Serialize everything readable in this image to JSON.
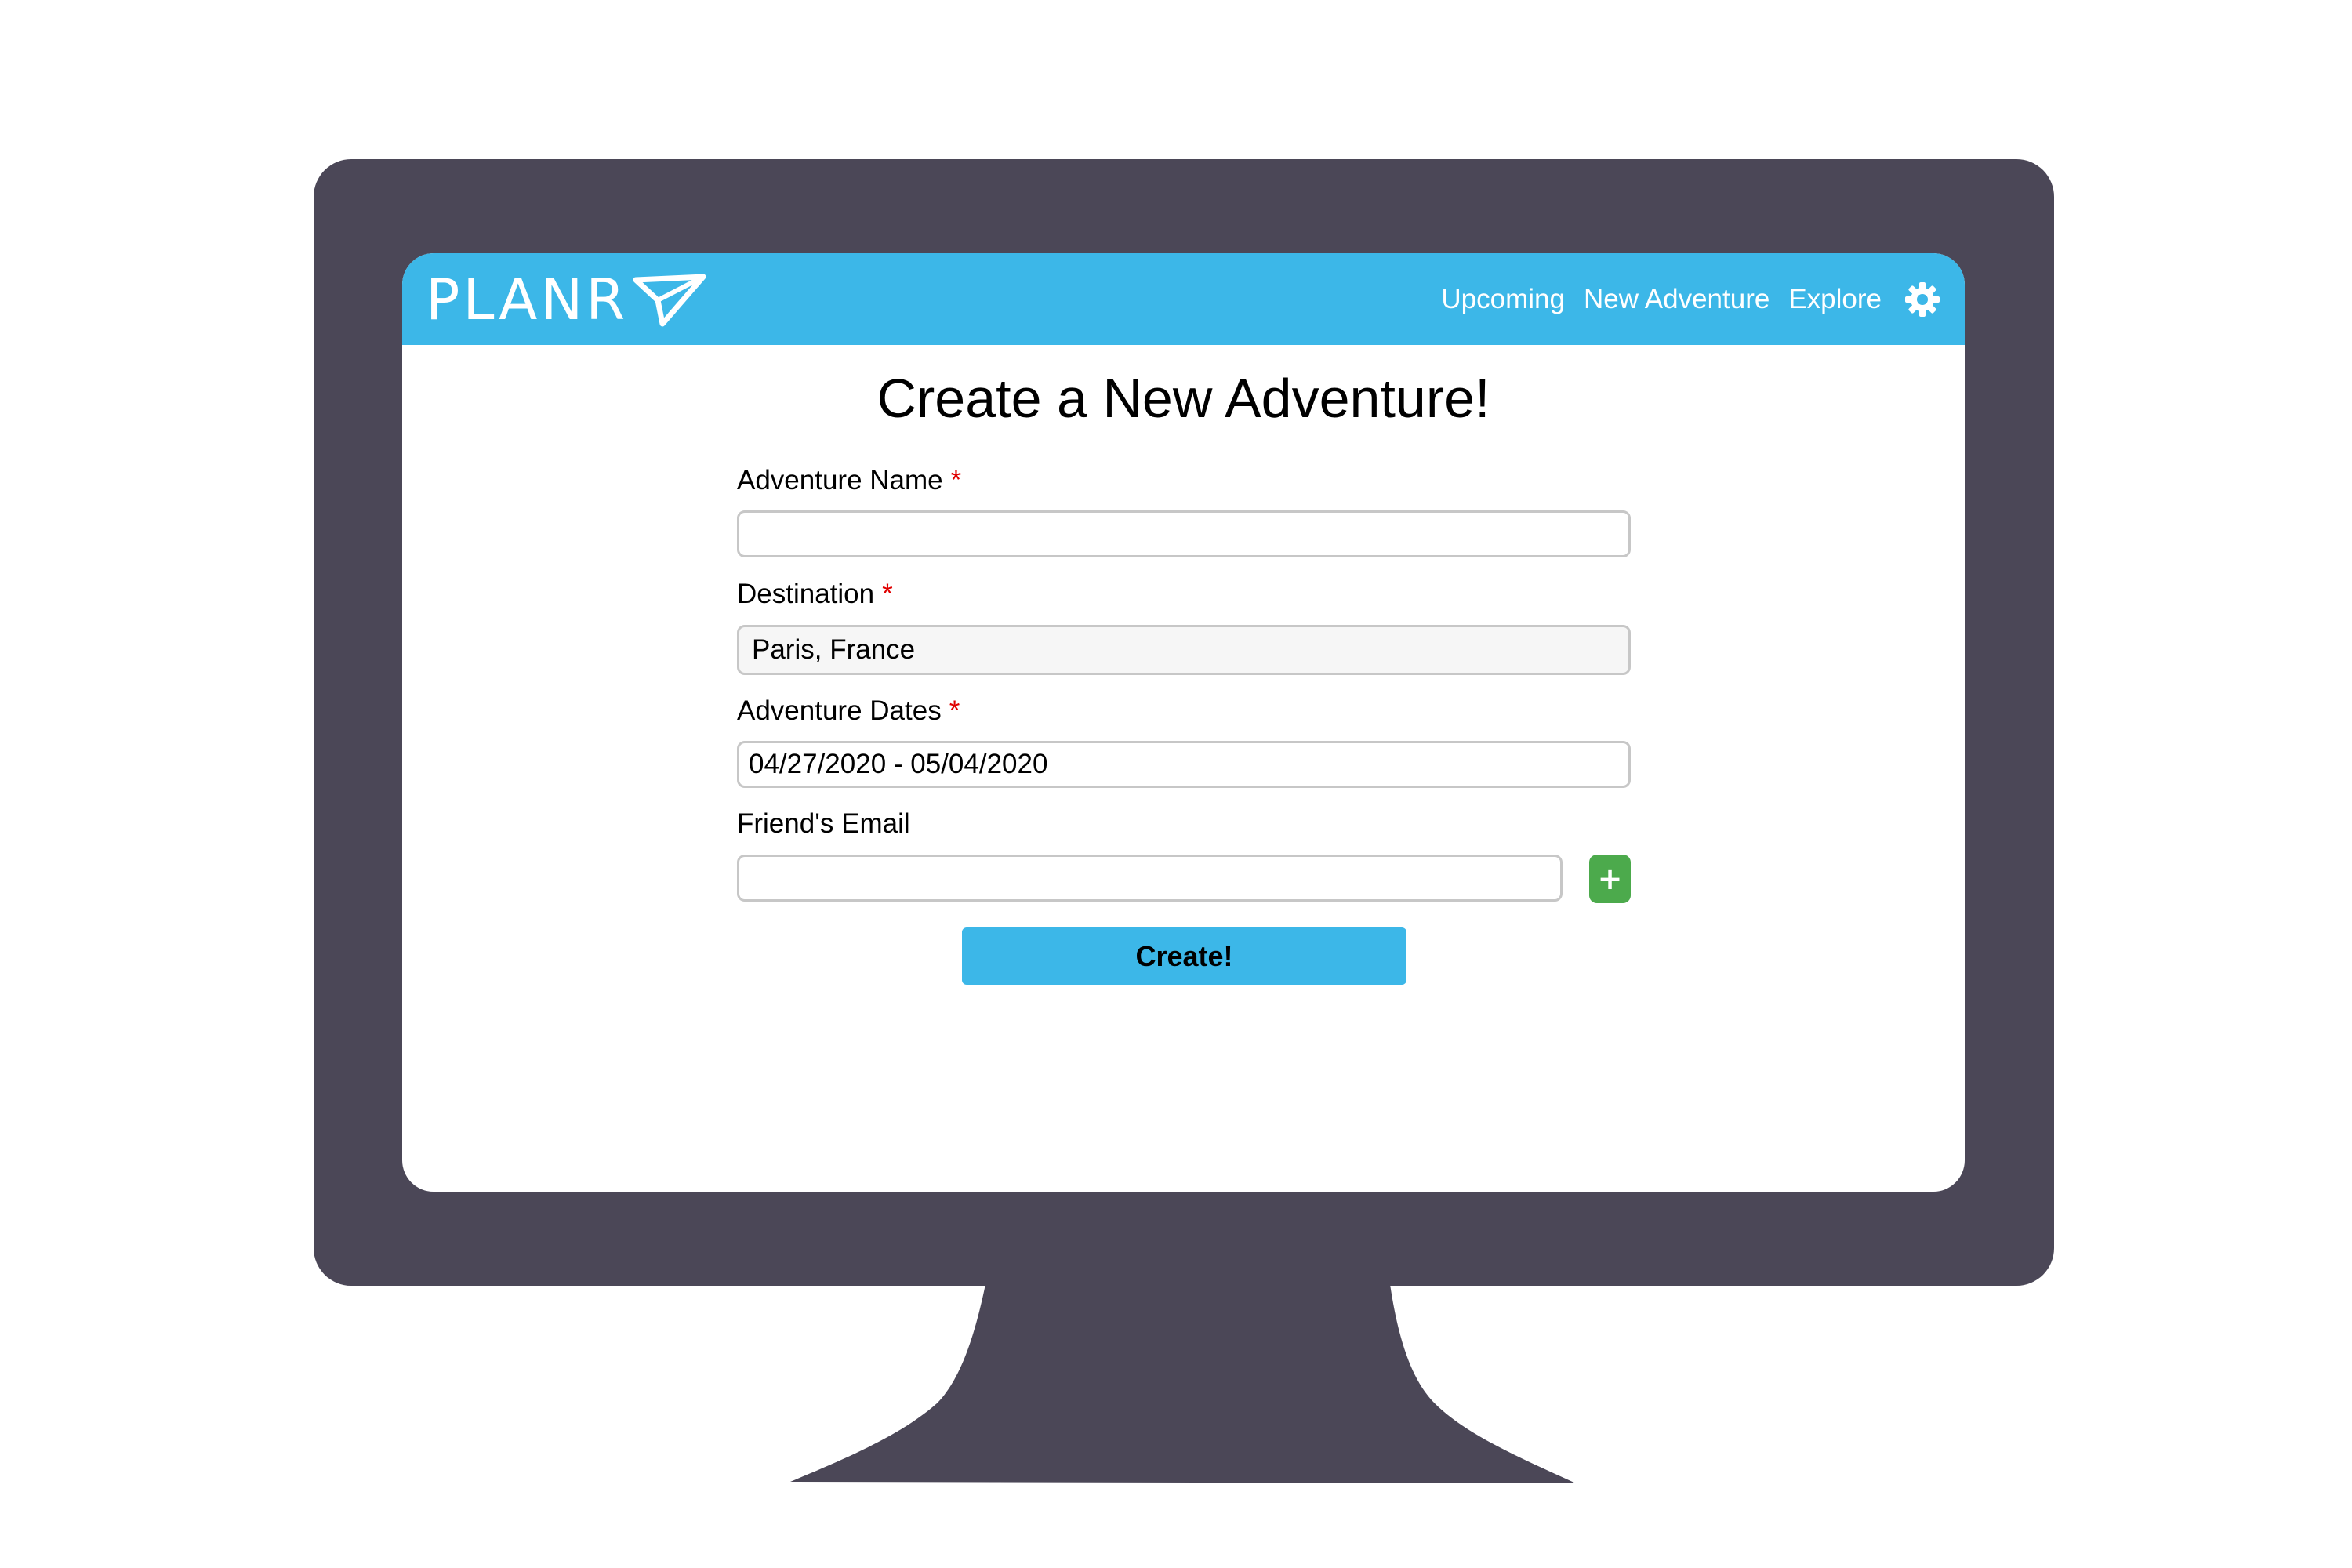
{
  "colors": {
    "navbar": "#3cb7e8",
    "monitor": "#4b4757",
    "required": "#e00000",
    "add_button": "#4caa4c",
    "create_button": "#3cb7e8"
  },
  "navbar": {
    "logo_text": "PLANR",
    "logo_icon": "paper-plane-icon",
    "links": [
      "Upcoming",
      "New Adventure",
      "Explore"
    ],
    "settings_icon": "gear-icon"
  },
  "page": {
    "title": "Create a New Adventure!"
  },
  "form": {
    "required_marker": "*",
    "adventure_name": {
      "label": "Adventure Name",
      "value": ""
    },
    "destination": {
      "label": "Destination",
      "value": "Paris, France"
    },
    "adventure_dates": {
      "label": "Adventure Dates",
      "value": "04/27/2020 - 05/04/2020"
    },
    "friend_email": {
      "label": "Friend's Email",
      "value": ""
    },
    "add_button_label": "+",
    "submit_label": "Create!"
  }
}
